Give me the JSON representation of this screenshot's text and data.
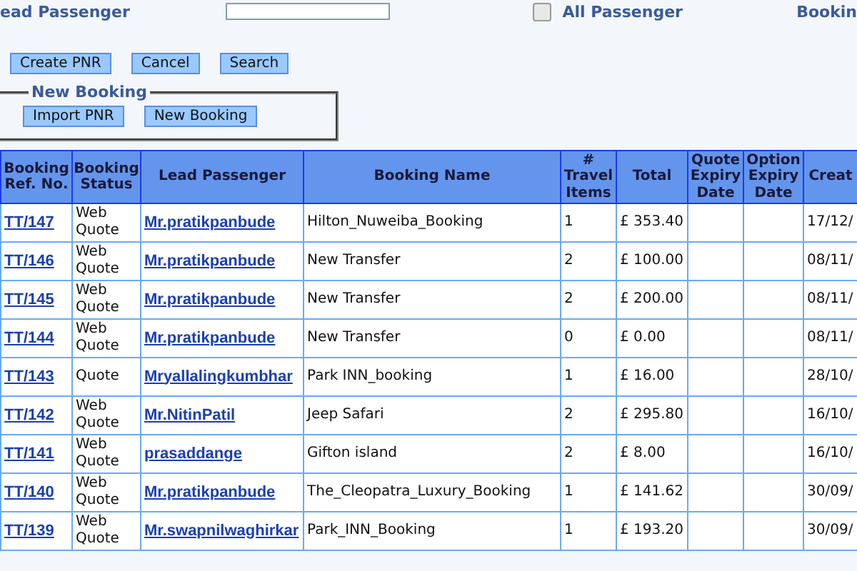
{
  "filters": {
    "lead_passenger_label": "ead Passenger",
    "all_passenger": {
      "label": "All Passenger",
      "checked": false
    },
    "booking_label": "Bookin"
  },
  "actions": [
    "Create PNR",
    "Cancel",
    "Search"
  ],
  "new_booking": {
    "legend": "New Booking",
    "buttons": [
      "Import PNR",
      "New Booking"
    ]
  },
  "table": {
    "columns": [
      "Booking Ref. No.",
      "Booking Status",
      "Lead Passenger",
      "Booking Name",
      "# Travel Items",
      "Total",
      "Quote Expiry Date",
      "Option Expiry Date",
      "Creat"
    ],
    "rows": [
      {
        "ref": "TT/147",
        "status": "Web Quote",
        "passenger": "Mr.pratikpanbude",
        "name": "Hilton_Nuweiba_Booking",
        "items": "1",
        "total": "£ 353.40",
        "created": "17/12/"
      },
      {
        "ref": "TT/146",
        "status": "Web Quote",
        "passenger": "Mr.pratikpanbude",
        "name": "New Transfer",
        "items": "2",
        "total": "£ 100.00",
        "created": "08/11/"
      },
      {
        "ref": "TT/145",
        "status": "Web Quote",
        "passenger": "Mr.pratikpanbude",
        "name": "New Transfer",
        "items": "2",
        "total": "£ 200.00",
        "created": "08/11/"
      },
      {
        "ref": "TT/144",
        "status": "Web Quote",
        "passenger": "Mr.pratikpanbude",
        "name": "New Transfer",
        "items": "0",
        "total": "£ 0.00",
        "created": "08/11/"
      },
      {
        "ref": "TT/143",
        "status": "Quote",
        "passenger": "Mryallalingkumbhar",
        "name": "Park INN_booking",
        "items": "1",
        "total": "£ 16.00",
        "created": "28/10/"
      },
      {
        "ref": "TT/142",
        "status": "Web Quote",
        "passenger": "Mr.NitinPatil",
        "name": "Jeep Safari",
        "items": "2",
        "total": "£ 295.80",
        "created": "16/10/"
      },
      {
        "ref": "TT/141",
        "status": "Web Quote",
        "passenger": "prasaddange",
        "name": "Gifton island",
        "items": "2",
        "total": "£ 8.00",
        "created": "16/10/"
      },
      {
        "ref": "TT/140",
        "status": "Web Quote",
        "passenger": "Mr.pratikpanbude",
        "name": "The_Cleopatra_Luxury_Booking",
        "items": "1",
        "total": "£ 141.62",
        "created": "30/09/"
      },
      {
        "ref": "TT/139",
        "status": "Web Quote",
        "passenger": "Mr.swapnilwaghirkar",
        "name": "Park_INN_Booking",
        "items": "1",
        "total": "£ 193.20",
        "created": "30/09/"
      }
    ]
  }
}
